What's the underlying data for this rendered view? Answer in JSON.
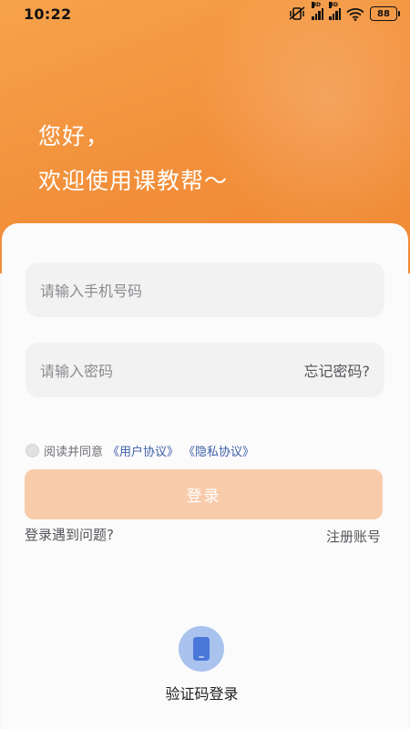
{
  "status_bar": {
    "time": "10:22",
    "battery": "88",
    "hd_label": "HD"
  },
  "greeting": {
    "line1": "您好，",
    "line2": "欢迎使用课教帮～"
  },
  "phone_input": {
    "placeholder": "请输入手机号码"
  },
  "password_input": {
    "placeholder": "请输入密码",
    "forgot_label": "忘记密码?"
  },
  "agreement": {
    "prefix": "阅读并同意",
    "user_agreement": "《用户协议》",
    "privacy_policy": "《隐私协议》",
    "checked": false
  },
  "login_button": {
    "label": "登录"
  },
  "links": {
    "problem": "登录遇到问题?",
    "register": "注册账号"
  },
  "sms_login": {
    "label": "验证码登录",
    "icon": "phone-icon"
  },
  "colors": {
    "hero": "#f28f3a",
    "login_button": "#f8ccab",
    "link": "#3d5ea8",
    "sms_icon_bg": "#a9c2ee"
  }
}
